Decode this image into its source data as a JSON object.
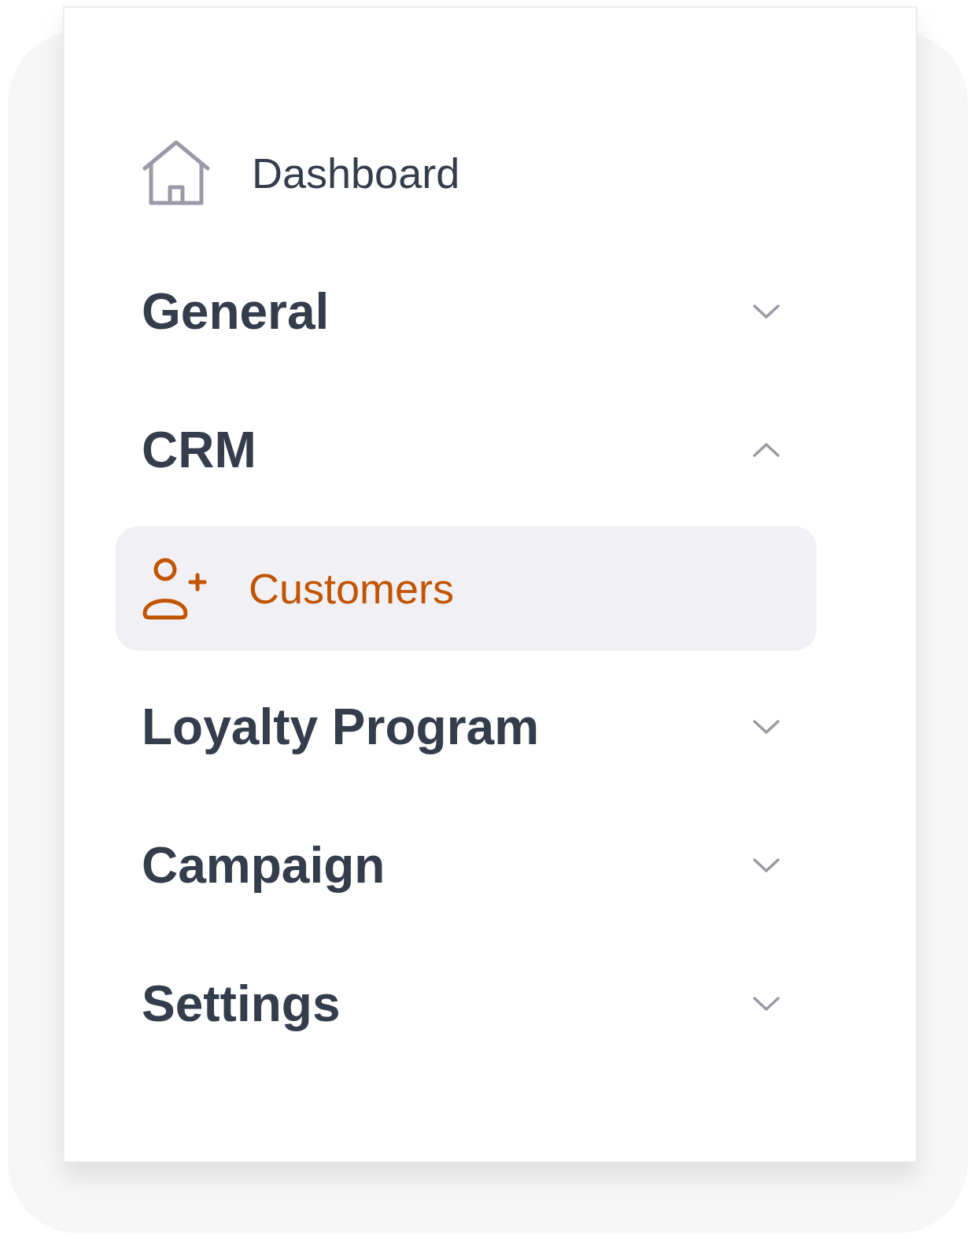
{
  "nav": [
    {
      "kind": "link",
      "label": "Dashboard",
      "selected": false
    },
    {
      "kind": "section",
      "label": "General",
      "expanded": false
    },
    {
      "kind": "section",
      "label": "CRM",
      "expanded": true,
      "children": [
        {
          "kind": "link",
          "label": "Customers",
          "selected": true
        }
      ]
    },
    {
      "kind": "section",
      "label": "Loyalty Program",
      "expanded": false
    },
    {
      "kind": "section",
      "label": "Campaign",
      "expanded": false
    },
    {
      "kind": "section",
      "label": "Settings",
      "expanded": false
    }
  ]
}
